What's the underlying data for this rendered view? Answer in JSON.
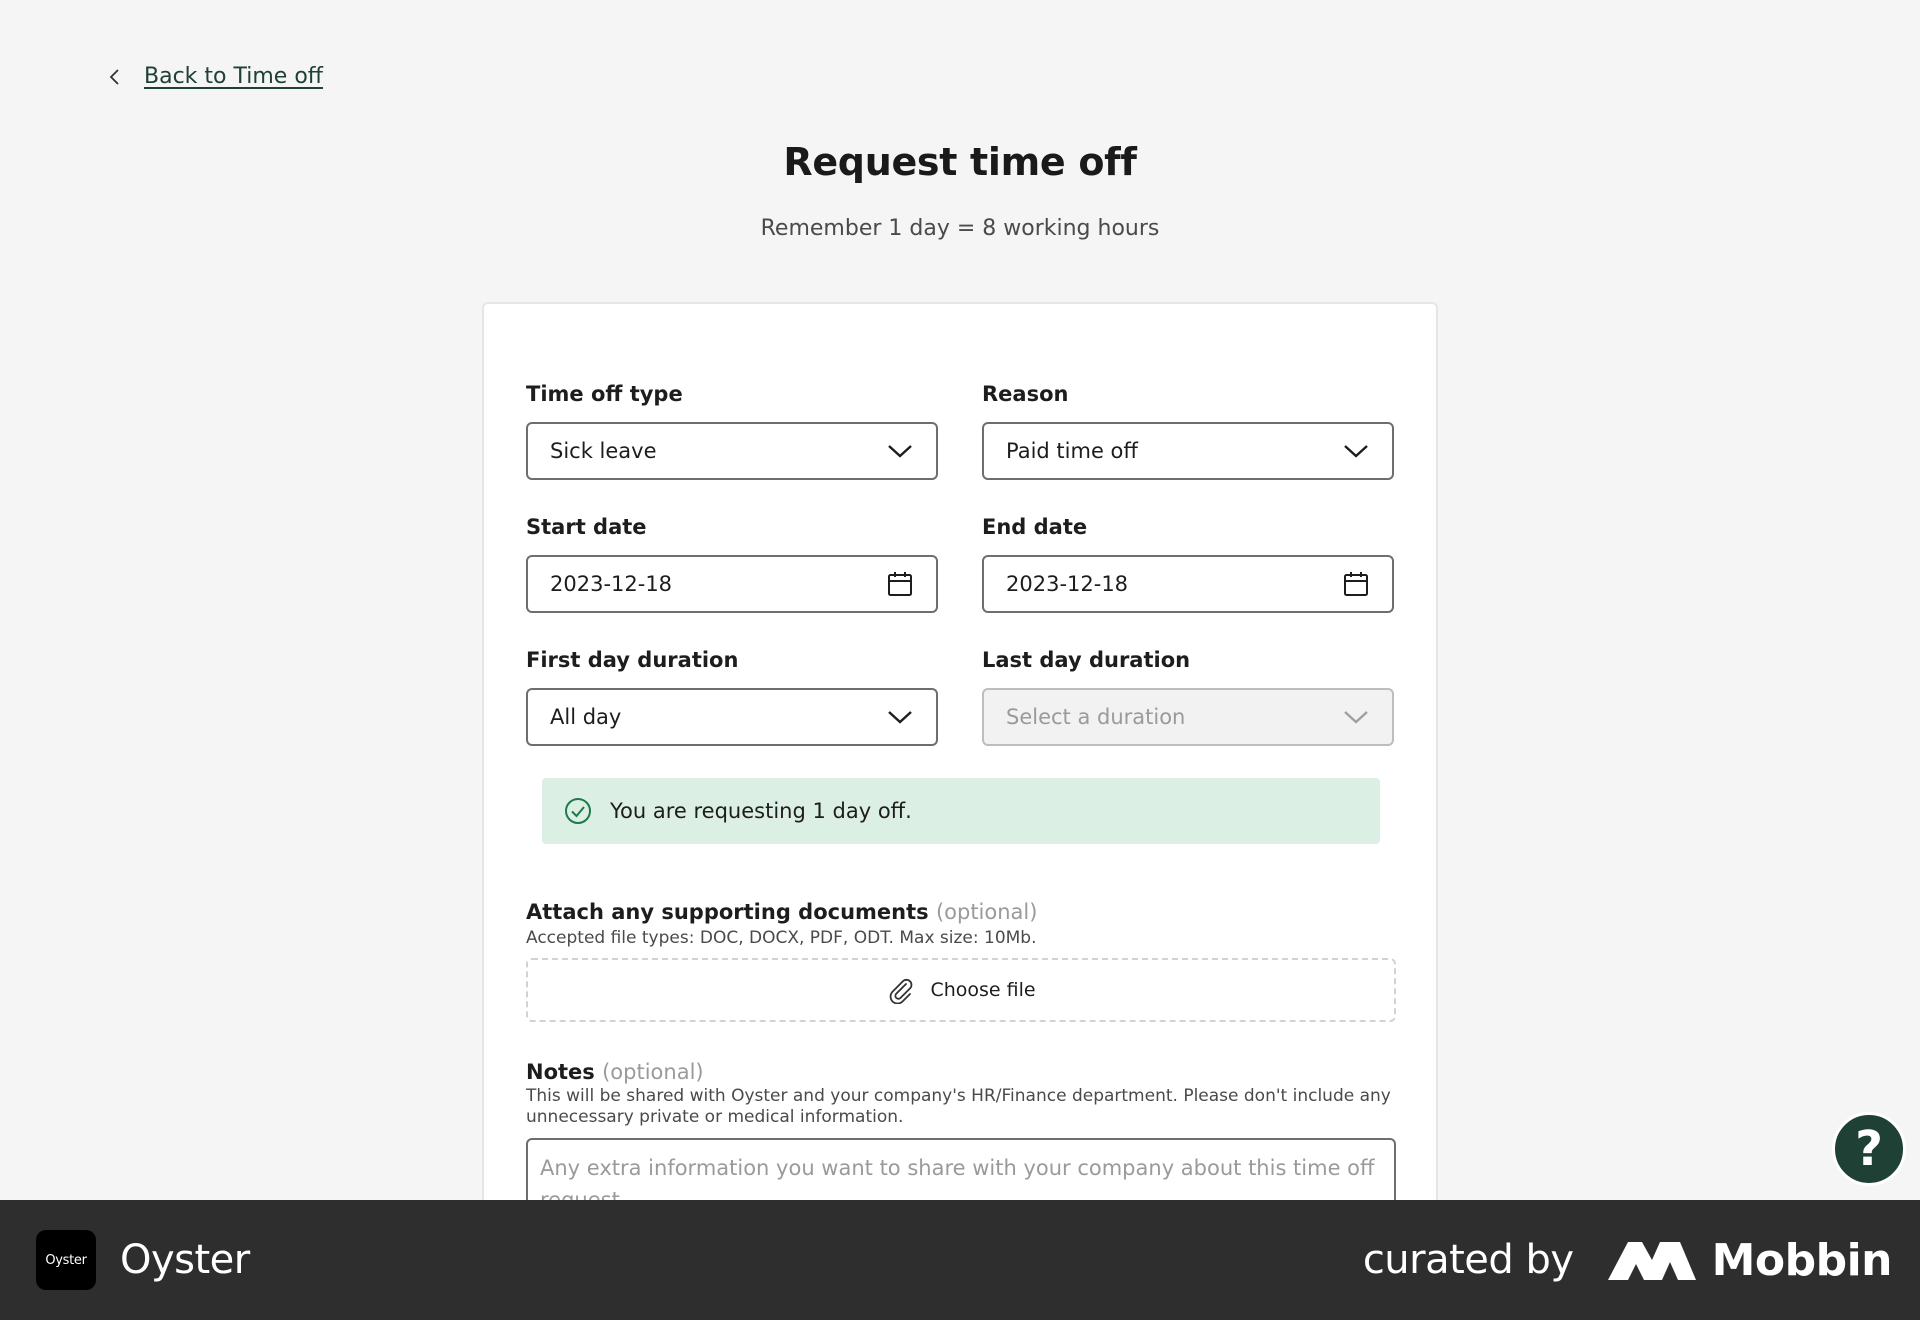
{
  "nav": {
    "back_label": "Back to Time off"
  },
  "header": {
    "title": "Request time off",
    "subtitle": "Remember 1 day = 8 working hours"
  },
  "form": {
    "time_off_type": {
      "label": "Time off type",
      "value": "Sick leave"
    },
    "reason": {
      "label": "Reason",
      "value": "Paid time off"
    },
    "start_date": {
      "label": "Start date",
      "value": "2023-12-18"
    },
    "end_date": {
      "label": "End date",
      "value": "2023-12-18"
    },
    "first_day_duration": {
      "label": "First day duration",
      "value": "All day"
    },
    "last_day_duration": {
      "label": "Last day duration",
      "placeholder": "Select a duration",
      "disabled": true
    },
    "notice": {
      "text": "You are requesting 1 day off.",
      "color": "#dcefe5"
    },
    "attachments": {
      "label": "Attach any supporting documents",
      "optional": "(optional)",
      "help": "Accepted file types: DOC, DOCX, PDF, ODT. Max size: 10Mb.",
      "button_label": "Choose file"
    },
    "notes": {
      "label": "Notes",
      "optional": "(optional)",
      "help": "This will be shared with Oyster and your company's HR/Finance department. Please don't include any unnecessary private or medical information.",
      "placeholder": "Any extra information you want to share with your company about this time off request"
    }
  },
  "help_button": {
    "label": "?"
  },
  "footer": {
    "app_logo_text": "Oyster",
    "app_name": "Oyster",
    "curated_by": "curated by",
    "brand": "Mobbin"
  },
  "colors": {
    "accent": "#1f4034",
    "notice_bg": "#dcefe5",
    "background": "#f5f5f5",
    "footer_bg": "#2e2e2e"
  },
  "icons": {
    "back": "chevron-left-icon",
    "select": "chevron-down-icon",
    "date": "calendar-icon",
    "notice": "check-circle-icon",
    "attach": "paperclip-icon"
  }
}
